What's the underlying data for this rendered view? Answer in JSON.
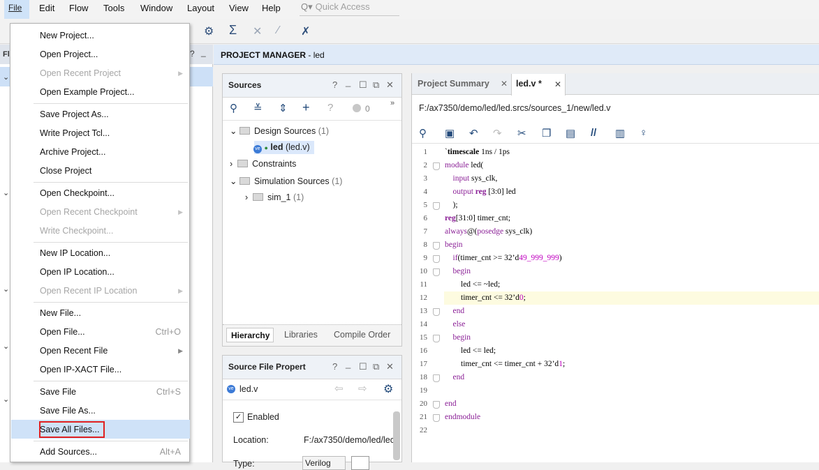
{
  "menubar": {
    "items": [
      "File",
      "Edit",
      "Flow",
      "Tools",
      "Window",
      "Layout",
      "View",
      "Help"
    ],
    "quick_access_placeholder": "Quick Access"
  },
  "project_manager": {
    "title": "PROJECT MANAGER",
    "project": "- led"
  },
  "sources_panel": {
    "title": "Sources",
    "count": "0",
    "tree": {
      "design_sources": "Design Sources",
      "design_sources_count": "(1)",
      "led_file": "led",
      "led_file_detail": "(led.v)",
      "constraints": "Constraints",
      "simulation_sources": "Simulation Sources",
      "simulation_sources_count": "(1)",
      "sim_1": "sim_1",
      "sim_1_count": "(1)"
    },
    "tabs": [
      "Hierarchy",
      "Libraries",
      "Compile Order"
    ]
  },
  "props_panel": {
    "title": "Source File Propert",
    "file": "led.v",
    "enabled_label": "Enabled",
    "location_label": "Location:",
    "location_value": "F:/ax7350/demo/led/lec",
    "type_label": "Type:",
    "type_value": "Verilog"
  },
  "editor": {
    "tabs": [
      "Project Summary",
      "led.v *"
    ],
    "path": "F:/ax7350/demo/led/led.srcs/sources_1/new/led.v",
    "line_numbers": [
      "1",
      "2",
      "3",
      "4",
      "5",
      "6",
      "7",
      "8",
      "9",
      "10",
      "11",
      "12",
      "13",
      "14",
      "15",
      "16",
      "17",
      "18",
      "19",
      "20",
      "21",
      "22"
    ]
  },
  "file_menu": {
    "items": [
      {
        "label": "New Project...",
        "shortcut": ""
      },
      {
        "label": "Open Project...",
        "shortcut": ""
      },
      {
        "label": "Open Recent Project",
        "shortcut": ""
      },
      {
        "label": "Open Example Project...",
        "shortcut": ""
      },
      {
        "label": "Save Project As...",
        "shortcut": ""
      },
      {
        "label": "Write Project Tcl...",
        "shortcut": ""
      },
      {
        "label": "Archive Project...",
        "shortcut": ""
      },
      {
        "label": "Close Project",
        "shortcut": ""
      },
      {
        "label": "Open Checkpoint...",
        "shortcut": ""
      },
      {
        "label": "Open Recent Checkpoint",
        "shortcut": ""
      },
      {
        "label": "Write Checkpoint...",
        "shortcut": ""
      },
      {
        "label": "New IP Location...",
        "shortcut": ""
      },
      {
        "label": "Open IP Location...",
        "shortcut": ""
      },
      {
        "label": "Open Recent IP Location",
        "shortcut": ""
      },
      {
        "label": "New File...",
        "shortcut": ""
      },
      {
        "label": "Open File...",
        "shortcut": "Ctrl+O"
      },
      {
        "label": "Open Recent File",
        "shortcut": ""
      },
      {
        "label": "Open IP-XACT File...",
        "shortcut": ""
      },
      {
        "label": "Save File",
        "shortcut": "Ctrl+S"
      },
      {
        "label": "Save File As...",
        "shortcut": ""
      },
      {
        "label": "Save All Files...",
        "shortcut": ""
      },
      {
        "label": "Add Sources...",
        "shortcut": "Alt+A"
      }
    ]
  },
  "colors": {
    "menu_highlight": "#cfe2f8",
    "red_annotation": "#e02020",
    "current_line": "#fdfbe0",
    "keyword": "#8a1f96",
    "number": "#c000c0"
  }
}
